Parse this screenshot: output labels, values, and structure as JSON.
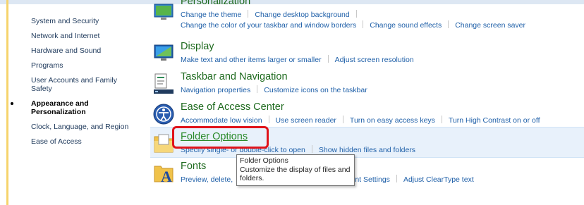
{
  "sidebar": {
    "items": [
      {
        "label": "System and Security"
      },
      {
        "label": "Network and Internet"
      },
      {
        "label": "Hardware and Sound"
      },
      {
        "label": "Programs"
      },
      {
        "label": "User Accounts and Family Safety"
      },
      {
        "label": "Appearance and Personalization"
      },
      {
        "label": "Clock, Language, and Region"
      },
      {
        "label": "Ease of Access"
      }
    ]
  },
  "categories": {
    "personalization": {
      "title": "Personalization",
      "links_row1": [
        "Change the theme",
        "Change desktop background"
      ],
      "links_row2": [
        "Change the color of your taskbar and window borders",
        "Change sound effects",
        "Change screen saver"
      ]
    },
    "display": {
      "title": "Display",
      "links": [
        "Make text and other items larger or smaller",
        "Adjust screen resolution"
      ]
    },
    "taskbar": {
      "title": "Taskbar and Navigation",
      "links": [
        "Navigation properties",
        "Customize icons on the taskbar"
      ]
    },
    "ease": {
      "title": "Ease of Access Center",
      "links": [
        "Accommodate low vision",
        "Use screen reader",
        "Turn on easy access keys",
        "Turn High Contrast on or off"
      ]
    },
    "folder": {
      "title": "Folder Options",
      "links": [
        "Specify single- or double-click to open",
        "Show hidden files and folders"
      ]
    },
    "fonts": {
      "title": "Fonts",
      "links": [
        "Preview, delete,",
        "Font Settings",
        "Adjust ClearType text"
      ]
    }
  },
  "tooltip": {
    "title": "Folder Options",
    "text": "Customize the display of files and folders."
  }
}
